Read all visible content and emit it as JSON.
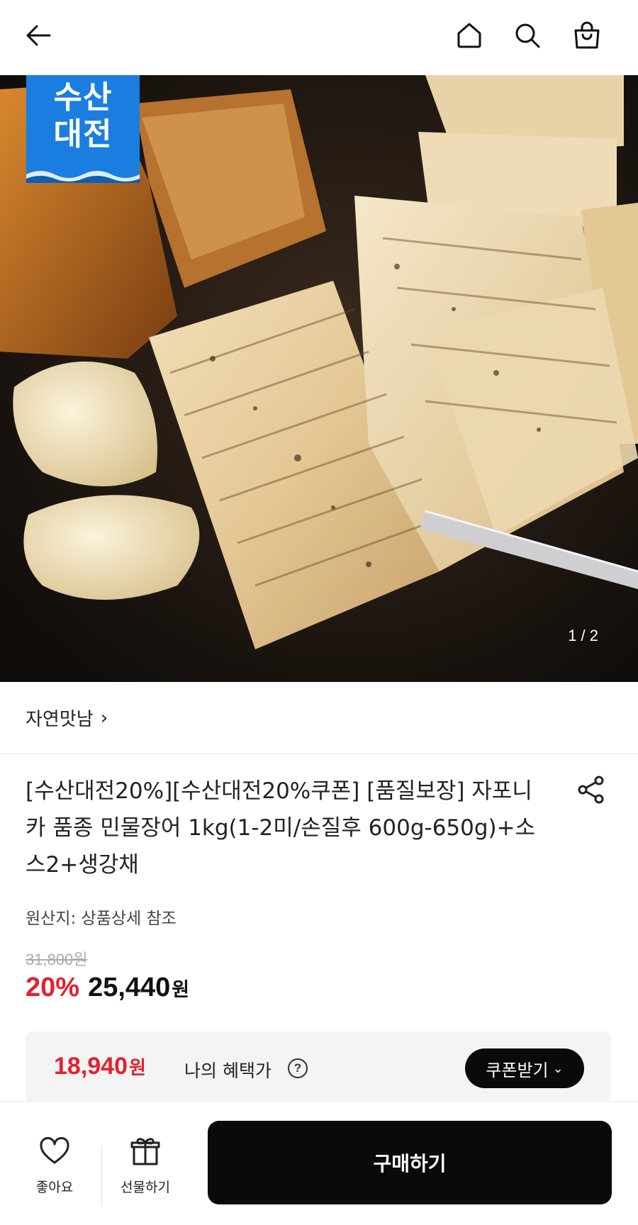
{
  "header": {
    "icons": [
      "back-arrow-icon",
      "home-icon",
      "search-icon",
      "shopping-bag-icon"
    ]
  },
  "hero": {
    "badge": {
      "line1": "수산",
      "line2": "대전",
      "color": "#1a7ee0"
    },
    "counter": "1 / 2"
  },
  "seller": {
    "name": "자연맛남",
    "chevron": "›"
  },
  "product": {
    "title": "[수산대전20%][수산대전20%쿠폰] [품질보장] 자포니카 품종 민물장어 1kg(1-2미/손질후 600g-650g)+소스2+생강채",
    "origin": "원산지: 상품상세 참조",
    "original_price": "31,800원",
    "discount": "20%",
    "sale_price": "25,440",
    "currency": "원"
  },
  "benefit": {
    "price": "18,940",
    "currency": "원",
    "label": "나의 혜택가",
    "help": "?",
    "coupon_button": "쿠폰받기",
    "coupon_chevron": "⌄"
  },
  "bottom_bar": {
    "like_label": "좋아요",
    "gift_label": "선물하기",
    "buy_label": "구매하기"
  },
  "colors": {
    "accent_red": "#e5202e",
    "badge_blue": "#1a7ee0",
    "dark": "#0a0a0a"
  }
}
